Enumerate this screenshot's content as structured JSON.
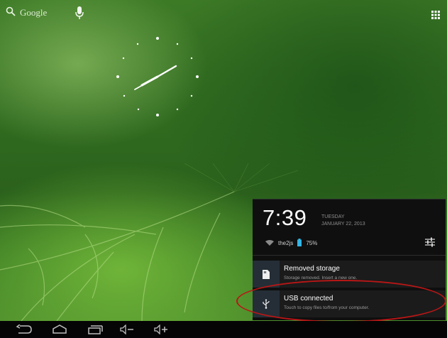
{
  "home": {
    "search_label": "Google"
  },
  "notification_panel": {
    "time": "7:39",
    "weekday": "TUESDAY",
    "date": "JANUARY 22, 2013",
    "wifi_name": "the2js",
    "battery_percent": "75%",
    "notifications": [
      {
        "title": "Removed storage",
        "text": "Storage removed. Insert a new one."
      },
      {
        "title": "USB connected",
        "text": "Touch to copy files to/from your computer."
      }
    ]
  },
  "icons": [
    "search-icon",
    "mic-icon",
    "all-apps-icon",
    "wifi-icon",
    "battery-icon",
    "quick-settings-icon",
    "sd-card-icon",
    "usb-icon",
    "back-icon",
    "home-icon",
    "recent-apps-icon",
    "volume-down-icon",
    "volume-up-icon"
  ],
  "colors": {
    "panel_bg": "#0f0f0f",
    "notification_bg": "#1b1b1b",
    "icon_box_bg": "#252e36",
    "battery_accent": "#33b5e5",
    "highlight_oval": "#b91616"
  }
}
